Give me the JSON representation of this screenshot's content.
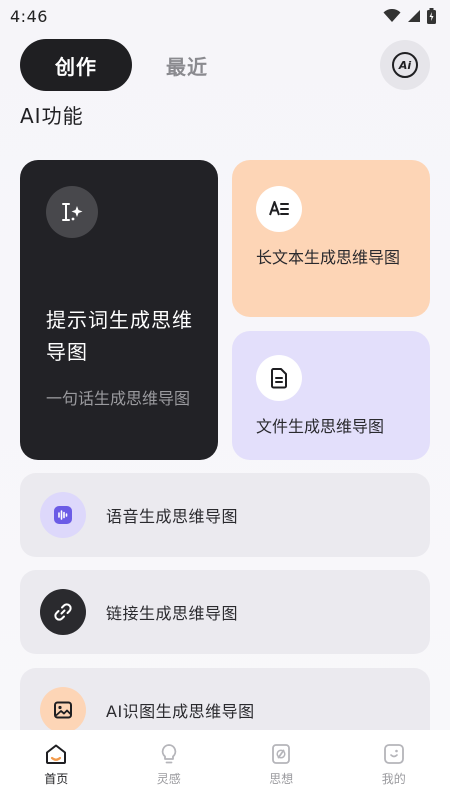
{
  "status_bar": {
    "time": "4:46"
  },
  "header": {
    "tab_active": "创作",
    "tab_inactive": "最近",
    "avatar_text": "Ai"
  },
  "section_title": "AI功能",
  "cards": {
    "prompt": {
      "title": "提示词生成思维导图",
      "subtitle": "一句话生成思维导图"
    },
    "long_text": {
      "title": "长文本生成思维导图"
    },
    "file": {
      "title": "文件生成思维导图"
    }
  },
  "list": [
    {
      "label": "语音生成思维导图",
      "icon": "audio-wave-icon"
    },
    {
      "label": "链接生成思维导图",
      "icon": "link-icon"
    },
    {
      "label": "AI识图生成思维导图",
      "icon": "image-icon"
    }
  ],
  "bottom_nav": [
    {
      "label": "首页",
      "icon": "home-icon",
      "active": true
    },
    {
      "label": "灵感",
      "icon": "lightbulb-icon",
      "active": false
    },
    {
      "label": "思想",
      "icon": "idea-card-icon",
      "active": false
    },
    {
      "label": "我的",
      "icon": "profile-icon",
      "active": false
    }
  ],
  "colors": {
    "dark": "#1f1f22",
    "orange_card": "#fdd5b6",
    "purple_card": "#e3dffb",
    "accent_orange": "#f29a4a"
  }
}
